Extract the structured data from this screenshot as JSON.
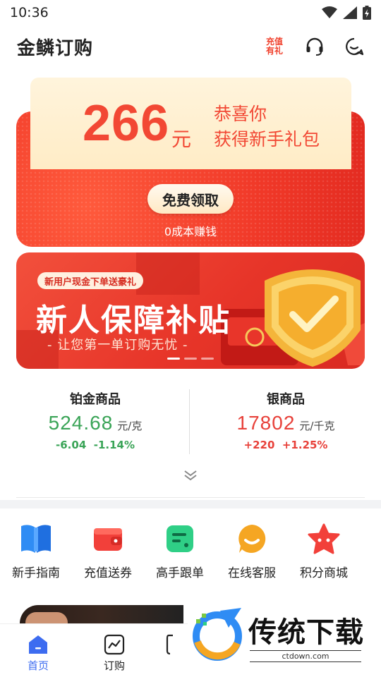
{
  "status_bar": {
    "time": "10:36"
  },
  "header": {
    "title": "金鳞订购",
    "recharge_badge": [
      "充值",
      "有礼"
    ]
  },
  "gift_card": {
    "amount": "266",
    "unit": "元",
    "message_line1": "恭喜你",
    "message_line2": "获得新手礼包",
    "claim_label": "免费领取",
    "subtext": "0成本赚钱"
  },
  "banner": {
    "tag": "新用户现金下单送豪礼",
    "title": "新人保障补贴",
    "subtitle": "- 让您第一单订购无忧 -",
    "slide_count": 3,
    "active_slide": 1
  },
  "prices": [
    {
      "name": "铂金商品",
      "value": "524.68",
      "unit": "元/克",
      "change": "-6.04",
      "change_pct": "-1.14%",
      "trend": "down"
    },
    {
      "name": "银商品",
      "value": "17802",
      "unit": "元/千克",
      "change": "+220",
      "change_pct": "+1.25%",
      "trend": "up"
    }
  ],
  "quick_nav": [
    {
      "label": "新手指南",
      "icon": "book-icon",
      "color": "#2f8cf4"
    },
    {
      "label": "充值送券",
      "icon": "wallet-icon",
      "color": "#f2403a"
    },
    {
      "label": "高手跟单",
      "icon": "document-icon",
      "color": "#2fcf86"
    },
    {
      "label": "在线客服",
      "icon": "chat-bubble-icon",
      "color": "#f5a623"
    },
    {
      "label": "积分商城",
      "icon": "star-icon",
      "color": "#f2403a"
    }
  ],
  "tabbar": [
    {
      "label": "首页",
      "icon": "home-icon",
      "active": true
    },
    {
      "label": "订购",
      "icon": "chart-icon",
      "active": false
    }
  ],
  "watermark": {
    "title": "传统下载",
    "url": "ctdown.com"
  },
  "colors": {
    "accent_red": "#f24834",
    "price_down": "#3aa457",
    "price_up": "#e8413a",
    "tab_active": "#3d6cf0"
  }
}
